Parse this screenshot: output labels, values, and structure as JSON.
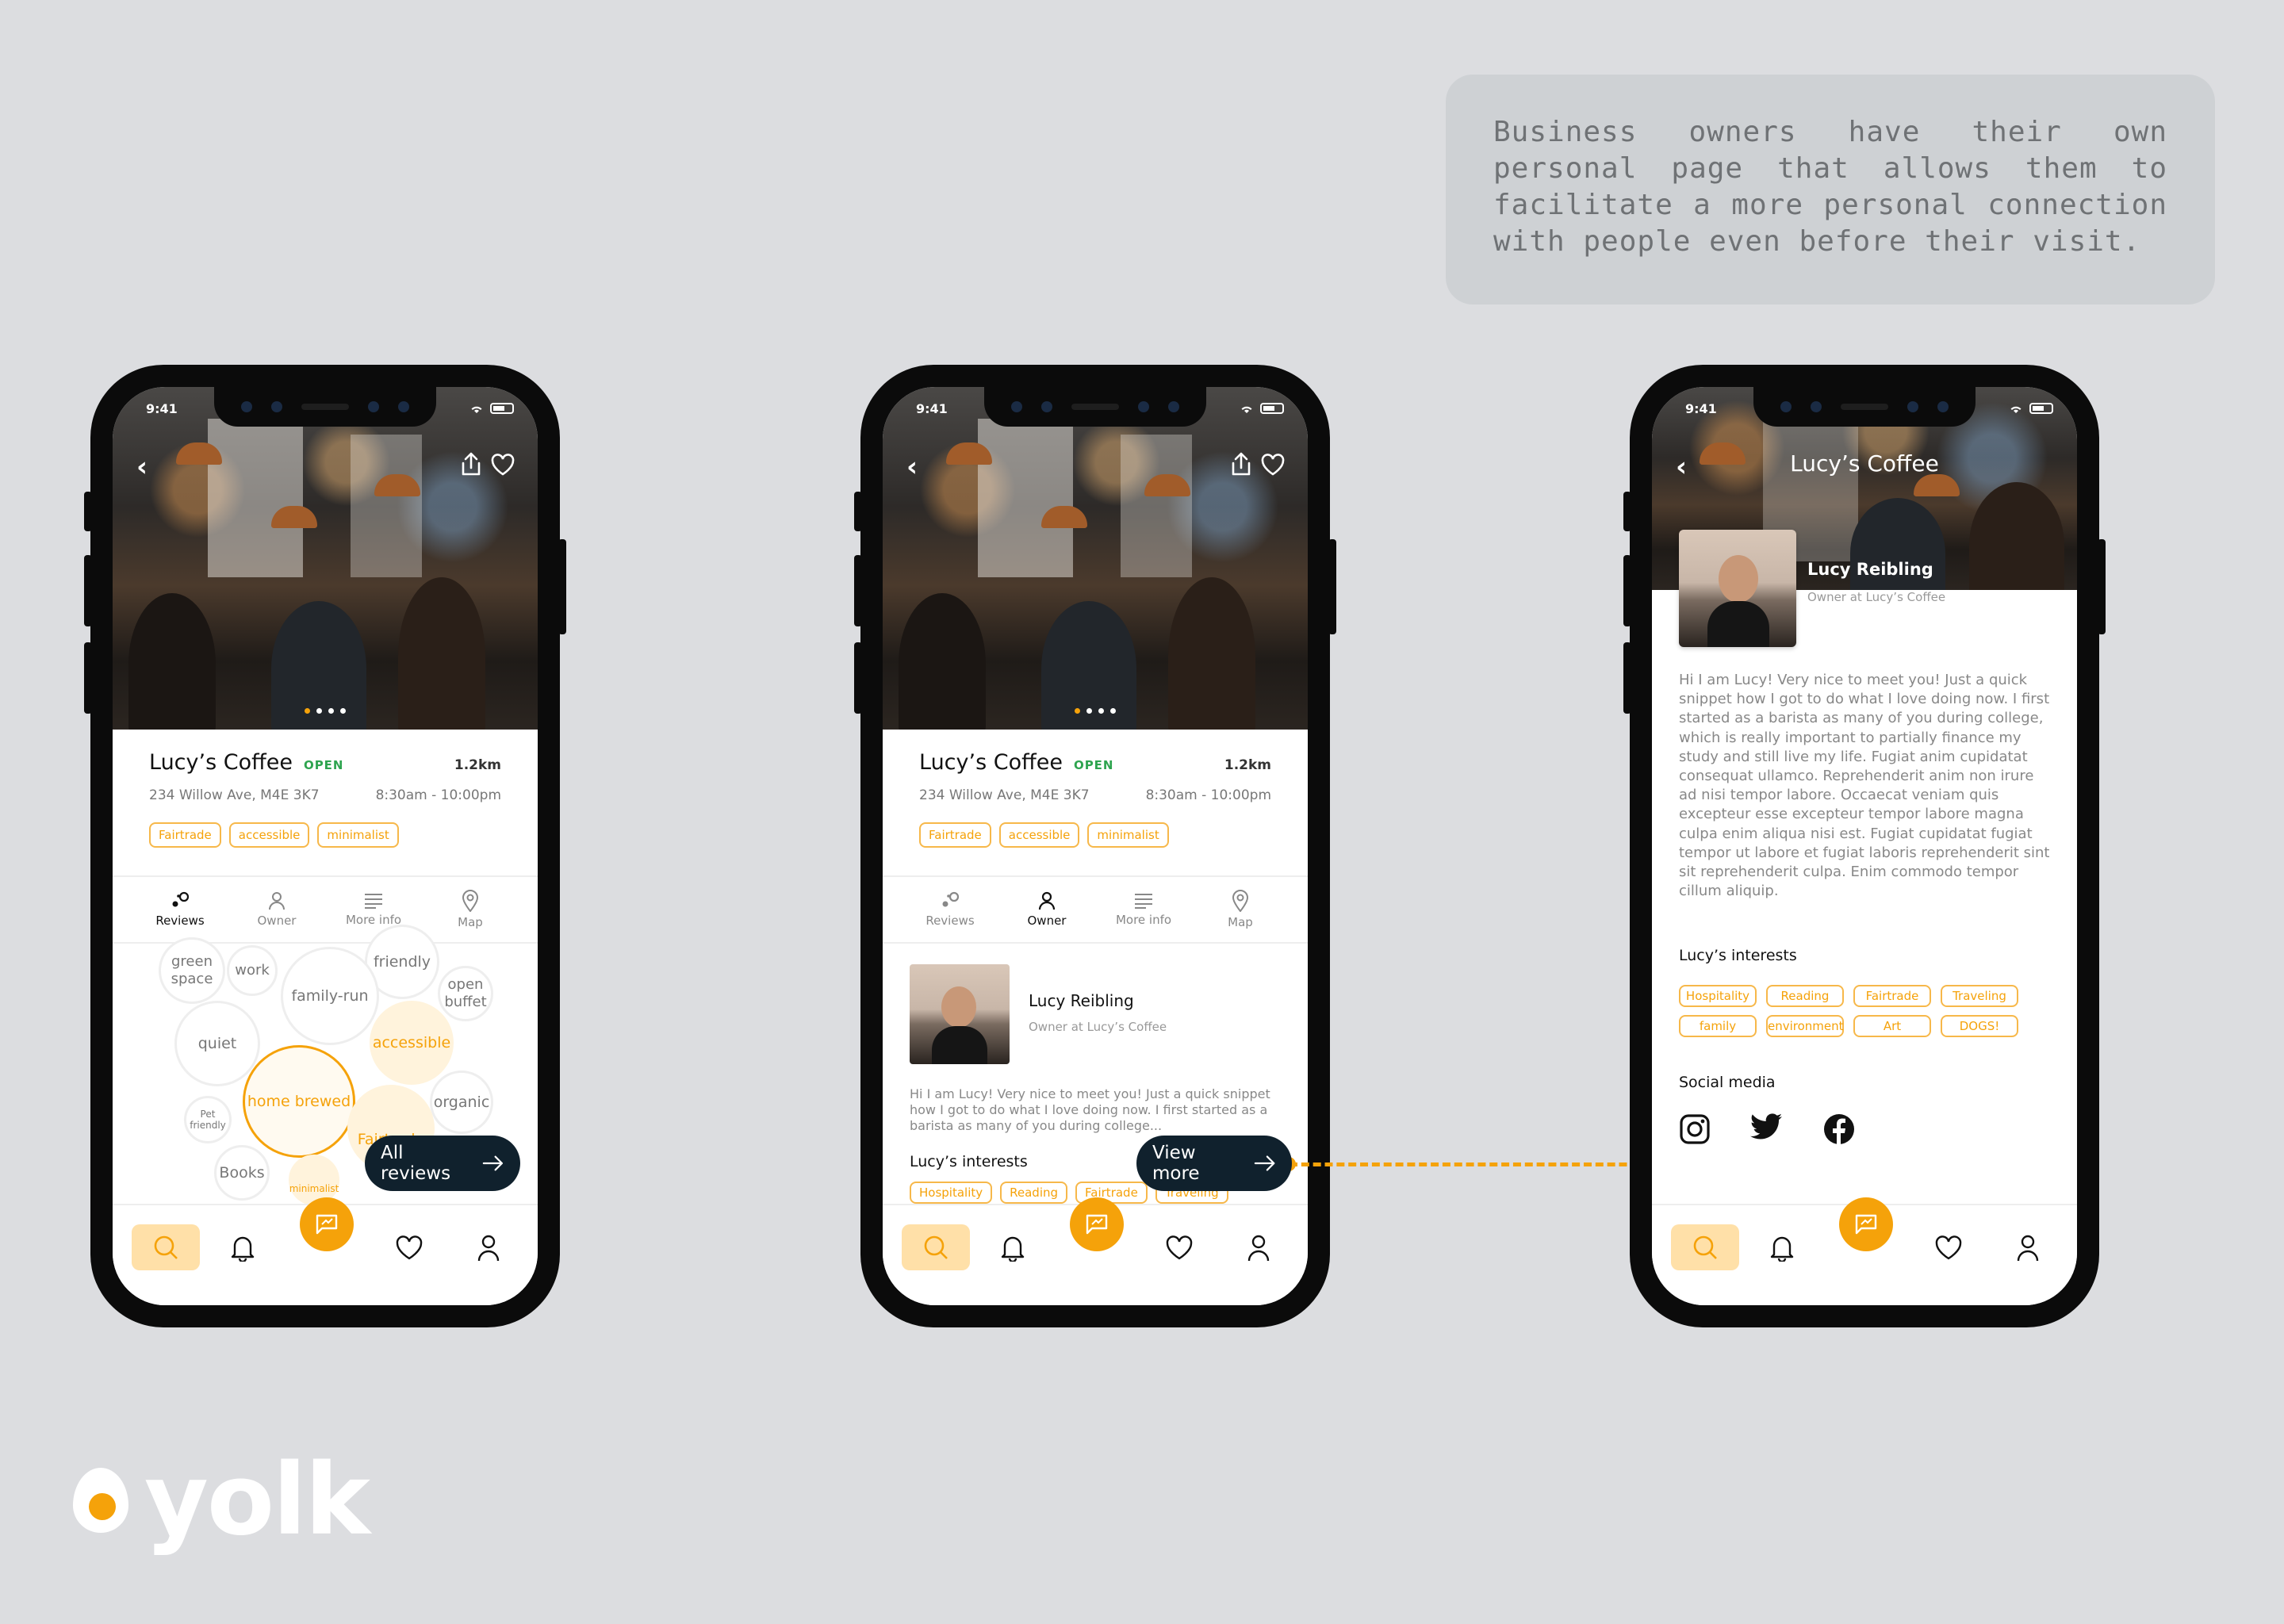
{
  "note": {
    "text": "Business owners have their own personal page that allows them to facilitate a more personal connection with people even before their visit."
  },
  "brand": {
    "name": "yolk",
    "accent": "#f5a20a",
    "dark": "#10212d"
  },
  "status": {
    "time": "9:41"
  },
  "place": {
    "name": "Lucy’s Coffee",
    "open": "OPEN",
    "distance": "1.2km",
    "address": "234 Willow Ave, M4E 3K7",
    "hours": "8:30am - 10:00pm",
    "tags": [
      "Fairtrade",
      "accessible",
      "minimalist"
    ]
  },
  "tabs": [
    {
      "label": "Reviews",
      "icon": "reviews-icon"
    },
    {
      "label": "Owner",
      "icon": "person-icon"
    },
    {
      "label": "More info",
      "icon": "list-icon"
    },
    {
      "label": "Map",
      "icon": "map-pin-icon"
    }
  ],
  "bubbles": [
    "green space",
    "work",
    "friendly",
    "family-run",
    "open buffet",
    "quiet",
    "accessible",
    "home brewed",
    "Pet friendly",
    "organic",
    "Fairtrade",
    "Books",
    "minimalist"
  ],
  "screen1": {
    "cta": "All reviews"
  },
  "screen2": {
    "cta": "View more"
  },
  "owner": {
    "name": "Lucy Reibling",
    "role": "Owner at Lucy’s Coffee",
    "bio_short": "Hi I am Lucy! Very nice to meet you! Just a quick snippet how I got to do what I love doing now. I first started as a barista as many of you during college...",
    "bio_full": "Hi I am Lucy! Very nice to meet you! Just a quick snippet how I got to do what I love doing now. I first started as a barista as many of you during college, which is really important to partially finance my study and still live my life. Fugiat anim cupidatat consequat ullamco. Reprehenderit anim non irure ad nisi tempor labore. Occaecat veniam quis excepteur esse excepteur tempor labore magna culpa enim aliqua nisi est. Fugiat cupidatat fugiat tempor ut labore et fugiat laboris reprehenderit sint sit reprehenderit culpa. Enim commodo tempor cillum aliquip.",
    "interests_title": "Lucy’s interests",
    "interests": [
      "Hospitality",
      "Reading",
      "Fairtrade",
      "Traveling",
      "family",
      "environment",
      "Art",
      "DOGS!"
    ],
    "social_title": "Social media",
    "social": [
      "instagram-icon",
      "twitter-icon",
      "facebook-icon"
    ]
  },
  "screen3": {
    "title": "Lucy’s Coffee"
  }
}
